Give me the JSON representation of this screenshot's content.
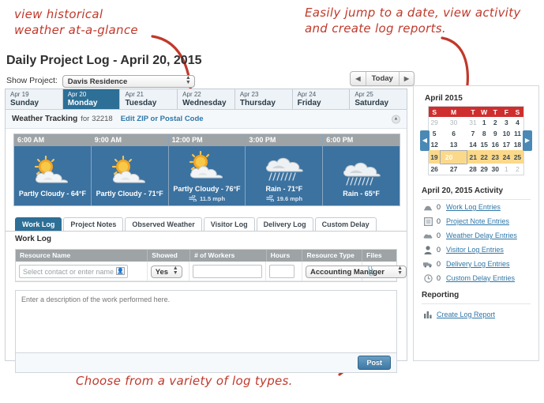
{
  "annotations": {
    "left": "view historical\nweather at-a-glance",
    "right": "Easily jump to a date, view activity\nand create log reports.",
    "bottom": "Choose from a variety of log types."
  },
  "header": {
    "page_title": "Daily Project Log - April 20, 2015",
    "show_project_label": "Show Project:",
    "project_selected": "Davis Residence",
    "nav": {
      "prev": "◀",
      "today": "Today",
      "next": "▶"
    }
  },
  "day_tabs": [
    {
      "date": "Apr 19",
      "day": "Sunday",
      "active": false
    },
    {
      "date": "Apr 20",
      "day": "Monday",
      "active": true
    },
    {
      "date": "Apr 21",
      "day": "Tuesday",
      "active": false
    },
    {
      "date": "Apr 22",
      "day": "Wednesday",
      "active": false
    },
    {
      "date": "Apr 23",
      "day": "Thursday",
      "active": false
    },
    {
      "date": "Apr 24",
      "day": "Friday",
      "active": false
    },
    {
      "date": "Apr 25",
      "day": "Saturday",
      "active": false
    }
  ],
  "weather": {
    "title": "Weather Tracking",
    "for_label": "for",
    "zip": "32218",
    "edit_link": "Edit ZIP or Postal Code",
    "collapse_icon": "collapse-icon",
    "cells": [
      {
        "time": "6:00 AM",
        "icon": "partly-cloudy-icon",
        "text": "Partly Cloudy - 64°F",
        "wind": ""
      },
      {
        "time": "9:00 AM",
        "icon": "partly-cloudy-icon",
        "text": "Partly Cloudy - 71°F",
        "wind": ""
      },
      {
        "time": "12:00 PM",
        "icon": "partly-cloudy-icon",
        "text": "Partly Cloudy - 76°F",
        "wind": "11.5 mph"
      },
      {
        "time": "3:00 PM",
        "icon": "rain-icon",
        "text": "Rain - 71°F",
        "wind": "19.6 mph"
      },
      {
        "time": "6:00 PM",
        "icon": "rain-icon",
        "text": "Rain - 65°F",
        "wind": ""
      }
    ]
  },
  "log_tabs": [
    {
      "label": "Work Log",
      "active": true
    },
    {
      "label": "Project Notes",
      "active": false
    },
    {
      "label": "Observed Weather",
      "active": false
    },
    {
      "label": "Visitor Log",
      "active": false
    },
    {
      "label": "Delivery Log",
      "active": false
    },
    {
      "label": "Custom Delay",
      "active": false
    }
  ],
  "work_log": {
    "section_label": "Work Log",
    "columns": [
      "Resource Name",
      "Showed",
      "# of Workers",
      "Hours",
      "Resource Type",
      "Files"
    ],
    "resource_name_placeholder": "Select contact or enter name.",
    "showed_value": "Yes",
    "workers_value": "",
    "hours_value": "",
    "resource_type_value": "Accounting Manager",
    "attach_label": "Attach",
    "description_placeholder": "Enter a description of the work performed here.",
    "post_label": "Post"
  },
  "sidebar": {
    "calendar": {
      "title": "April 2015",
      "weekdays": [
        "S",
        "M",
        "T",
        "W",
        "T",
        "F",
        "S"
      ],
      "weeks": [
        [
          {
            "d": "29",
            "out": true
          },
          {
            "d": "30",
            "out": true
          },
          {
            "d": "31",
            "out": true
          },
          {
            "d": "1",
            "out": false
          },
          {
            "d": "2",
            "out": false
          },
          {
            "d": "3",
            "out": false
          },
          {
            "d": "4",
            "out": false
          }
        ],
        [
          {
            "d": "5",
            "out": false
          },
          {
            "d": "6",
            "out": false
          },
          {
            "d": "7",
            "out": false
          },
          {
            "d": "8",
            "out": false
          },
          {
            "d": "9",
            "out": false
          },
          {
            "d": "10",
            "out": false
          },
          {
            "d": "11",
            "out": false
          }
        ],
        [
          {
            "d": "12",
            "out": false
          },
          {
            "d": "13",
            "out": false
          },
          {
            "d": "14",
            "out": false
          },
          {
            "d": "15",
            "out": false
          },
          {
            "d": "16",
            "out": false
          },
          {
            "d": "17",
            "out": false
          },
          {
            "d": "18",
            "out": false
          }
        ],
        [
          {
            "d": "19",
            "out": false
          },
          {
            "d": "20",
            "out": false,
            "sel": true
          },
          {
            "d": "21",
            "out": false
          },
          {
            "d": "22",
            "out": false
          },
          {
            "d": "23",
            "out": false
          },
          {
            "d": "24",
            "out": false
          },
          {
            "d": "25",
            "out": false
          }
        ],
        [
          {
            "d": "26",
            "out": false
          },
          {
            "d": "27",
            "out": false
          },
          {
            "d": "28",
            "out": false
          },
          {
            "d": "29",
            "out": false
          },
          {
            "d": "30",
            "out": false
          },
          {
            "d": "1",
            "out": true
          },
          {
            "d": "2",
            "out": true
          }
        ]
      ],
      "selected_week_index": 3,
      "prev_label": "◀",
      "next_label": "▶"
    },
    "activity_title": "April 20, 2015 Activity",
    "activity": [
      {
        "icon": "hardhat-icon",
        "count": "0",
        "label": "Work Log Entries"
      },
      {
        "icon": "note-icon",
        "count": "0",
        "label": "Project Note Entries"
      },
      {
        "icon": "cloud-icon",
        "count": "0",
        "label": "Weather Delay Entries"
      },
      {
        "icon": "person-icon",
        "count": "0",
        "label": "Visitor Log Entries"
      },
      {
        "icon": "truck-icon",
        "count": "0",
        "label": "Delivery Log Entries"
      },
      {
        "icon": "clock-icon",
        "count": "0",
        "label": "Custom Delay Entries"
      }
    ],
    "reporting_title": "Reporting",
    "report_link": "Create Log Report",
    "report_icon": "bar-chart-icon"
  },
  "colors": {
    "accent_blue": "#2d6f96",
    "link_blue": "#2f77a8",
    "annotation_red": "#c0392b",
    "calendar_header_red": "#cf2e2e",
    "calendar_week_highlight": "#fbd98b",
    "weather_panel_blue": "#3b72a0",
    "header_gray": "#9ea3a6"
  }
}
